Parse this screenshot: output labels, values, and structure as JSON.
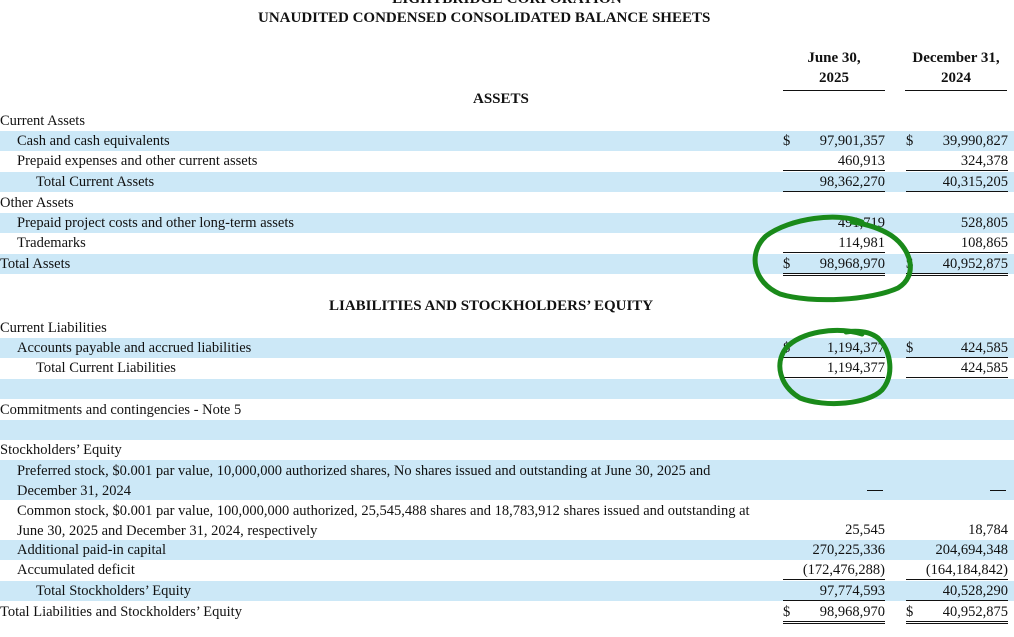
{
  "header": {
    "company": "LIGHTBRIDGE CORPORATION",
    "statement": "UNAUDITED CONDENSED CONSOLIDATED BALANCE SHEETS"
  },
  "columns": {
    "a_line1": "June 30,",
    "a_line2": "2025",
    "b_line1": "December 31,",
    "b_line2": "2024"
  },
  "sections": {
    "assets": "ASSETS",
    "liabilities": "LIABILITIES AND STOCKHOLDERS’ EQUITY"
  },
  "rows": {
    "current_assets": {
      "label": "Current Assets"
    },
    "cash": {
      "label": "Cash and cash equivalents",
      "cur": "$",
      "a": "97,901,357",
      "b": "39,990,827"
    },
    "prepaid": {
      "label": "Prepaid expenses and other current assets",
      "a": "460,913",
      "b": "324,378"
    },
    "total_current_assets": {
      "label": "Total Current Assets",
      "a": "98,362,270",
      "b": "40,315,205"
    },
    "other_assets": {
      "label": "Other Assets"
    },
    "prepaid_project": {
      "label": "Prepaid project costs and other long-term assets",
      "a": "491,719",
      "b": "528,805"
    },
    "trademarks": {
      "label": "Trademarks",
      "a": "114,981",
      "b": "108,865"
    },
    "total_assets": {
      "label": "Total Assets",
      "cur": "$",
      "a": "98,968,970",
      "b": "40,952,875"
    },
    "current_liabilities": {
      "label": "Current Liabilities"
    },
    "accounts_payable": {
      "label": "Accounts payable and accrued liabilities",
      "cur": "$",
      "a": "1,194,377",
      "b": "424,585"
    },
    "total_current_liabilities": {
      "label": "Total Current Liabilities",
      "a": "1,194,377",
      "b": "424,585"
    },
    "commitments": {
      "label": "Commitments and contingencies - Note 5"
    },
    "stockholders_equity": {
      "label": "Stockholders’ Equity"
    },
    "preferred": {
      "label": "Preferred stock, $0.001 par value, 10,000,000 authorized shares, No shares issued and outstanding at June 30, 2025 and December 31, 2024"
    },
    "common": {
      "label": "Common stock, $0.001 par value, 100,000,000 authorized, 25,545,488 shares and 18,783,912 shares issued and outstanding at June 30, 2025 and December 31, 2024, respectively",
      "a": "25,545",
      "b": "18,784"
    },
    "apic": {
      "label": "Additional paid-in capital",
      "a": "270,225,336",
      "b": "204,694,348"
    },
    "deficit": {
      "label": "Accumulated deficit",
      "a": "(172,476,288)",
      "b": "(164,184,842)"
    },
    "total_equity": {
      "label": "Total Stockholders’ Equity",
      "a": "97,774,593",
      "b": "40,528,290"
    },
    "total_liab_equity": {
      "label": "Total Liabilities and Stockholders’ Equity",
      "cur": "$",
      "a": "98,968,970",
      "b": "40,952,875"
    }
  },
  "colors": {
    "row_band": "#cce8f7",
    "annotation": "#1a8a1a"
  }
}
